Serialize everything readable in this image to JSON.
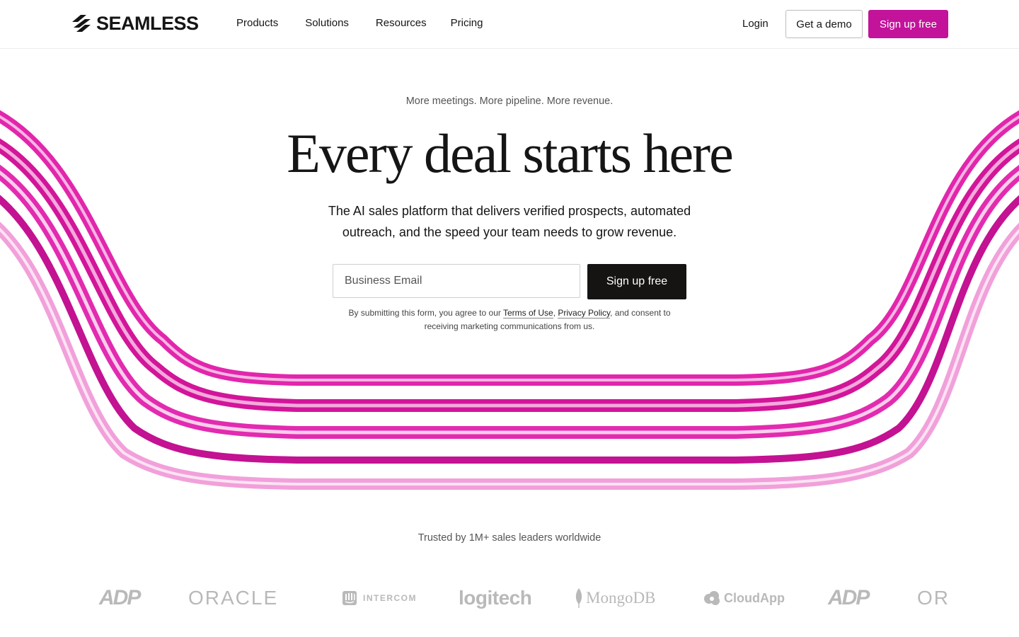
{
  "header": {
    "logo_text": "SEAMLESS",
    "nav": [
      "Products",
      "Solutions",
      "Resources",
      "Pricing"
    ],
    "login_label": "Login",
    "demo_label": "Get a demo",
    "signup_label": "Sign up free"
  },
  "hero": {
    "eyebrow": "More meetings. More pipeline. More revenue.",
    "headline": "Every deal starts here",
    "subhead": "The AI sales platform that delivers verified prospects, automated outreach, and the speed your team needs to grow revenue.",
    "email_placeholder": "Business Email",
    "signup_label": "Sign up free",
    "consent_prefix": "By submitting this form, you agree to our ",
    "consent_terms": "Terms of Use",
    "consent_comma": ", ",
    "consent_privacy": "Privacy Policy",
    "consent_suffix": ", and consent to receiving marketing communications from us."
  },
  "trusted": {
    "label": "Trusted by 1M+ sales leaders worldwide",
    "logos": [
      "ADP",
      "ORACLE",
      "INTERCOM",
      "logitech",
      "MongoDB",
      "CloudApp",
      "ADP",
      "ORACLE"
    ]
  },
  "colors": {
    "accent": "#c2139a",
    "ribbon": "#e01aa8",
    "dark_button": "#161412",
    "logo_gray": "#b9b9b9"
  }
}
